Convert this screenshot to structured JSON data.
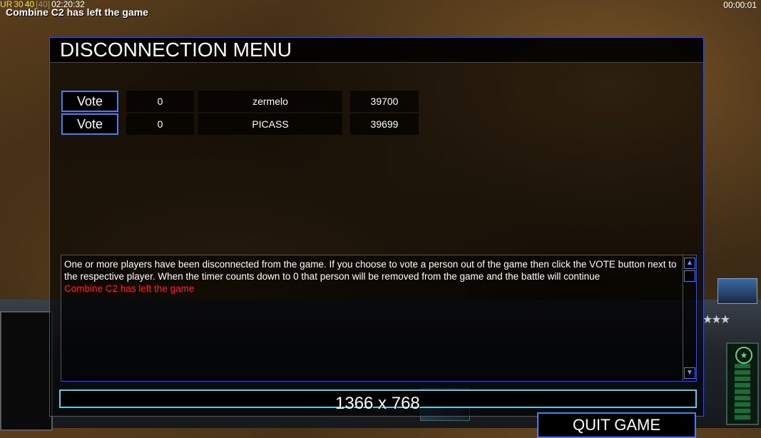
{
  "topbar": {
    "ur": "UR",
    "v1": "30",
    "v2": "40",
    "v3": "[40]",
    "time": "02:20:32",
    "clock": "00:00:01"
  },
  "notice": "Combine C2 has left the game",
  "panel": {
    "title": "DISCONNECTION MENU",
    "players": [
      {
        "vote_label": "Vote",
        "votes": "0",
        "name": "zermelo",
        "timer": "39700"
      },
      {
        "vote_label": "Vote",
        "votes": "0",
        "name": "PICASS",
        "timer": "39699"
      }
    ],
    "message": "One or more players have been disconnected from the game. If you choose to vote a person out of the game then click the VOTE button next to the respective player. When the timer counts down to 0 that person will be removed from the game and the battle will continue",
    "message_red": "Combine C2 has left the game",
    "chat_value": "",
    "quit_label": "QUIT GAME"
  },
  "overlay": {
    "resolution": "1366 x 768"
  },
  "icons": {
    "scroll_up": "triangle-up",
    "scroll_down": "triangle-down"
  },
  "colors": {
    "panel_border": "#3b4fd0",
    "button_border": "#4a7ef0",
    "chat_border": "#60c8e8",
    "alert_red": "#ff2020"
  }
}
